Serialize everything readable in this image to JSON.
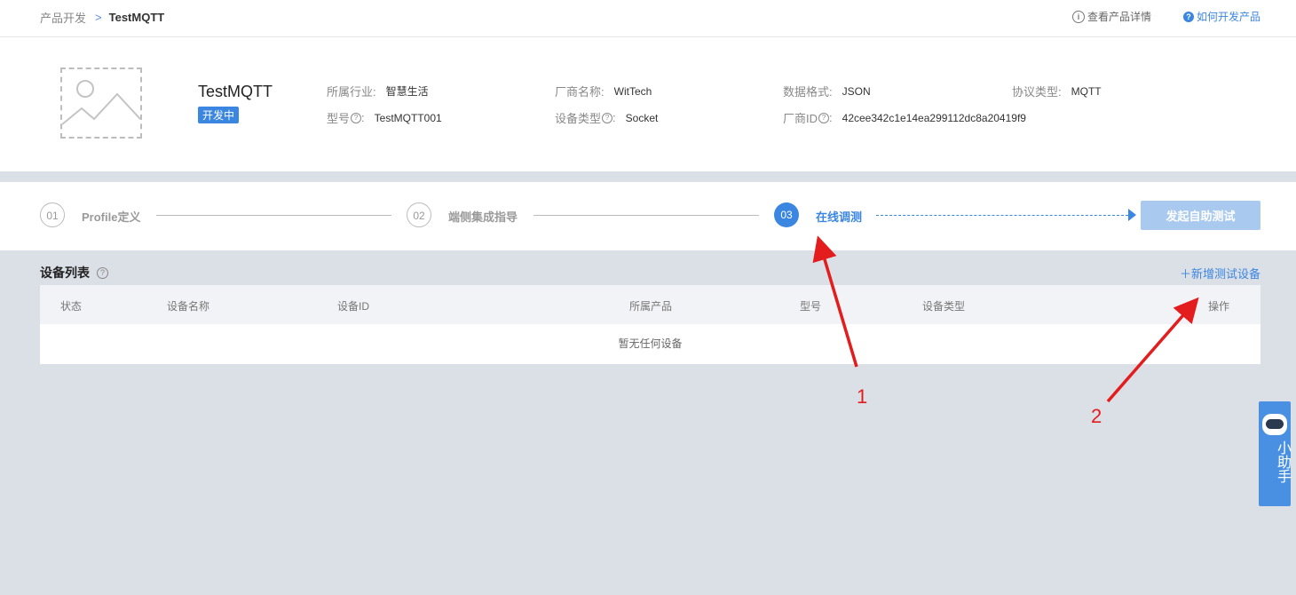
{
  "breadcrumb": {
    "parent": "产品开发",
    "separator": ">",
    "current": "TestMQTT"
  },
  "top_links": {
    "details": "查看产品详情",
    "how_to": "如何开发产品"
  },
  "product": {
    "name": "TestMQTT",
    "status": "开发中",
    "fields": {
      "industry_label": "所属行业:",
      "industry": "智慧生活",
      "vendor_label": "厂商名称:",
      "vendor": "WitTech",
      "data_format_label": "数据格式:",
      "data_format": "JSON",
      "protocol_label": "协议类型:",
      "protocol": "MQTT",
      "model_label": "型号",
      "model": "TestMQTT001",
      "device_type_label": "设备类型",
      "device_type": "Socket",
      "vendor_id_label": "厂商ID",
      "vendor_id": "42cee342c1e14ea299112dc8a20419f9"
    }
  },
  "steps": [
    {
      "num": "01",
      "label": "Profile定义",
      "state": "inactive"
    },
    {
      "num": "02",
      "label": "端侧集成指导",
      "state": "inactive"
    },
    {
      "num": "03",
      "label": "在线调测",
      "state": "active"
    }
  ],
  "self_test_button": "发起自助测试",
  "device_list": {
    "title": "设备列表",
    "add_button": "＋新增测试设备",
    "columns": [
      "状态",
      "设备名称",
      "设备ID",
      "所属产品",
      "型号",
      "设备类型",
      "操作"
    ],
    "empty_text": "暂无任何设备"
  },
  "helper": {
    "label": "小助手"
  },
  "annotations": {
    "one": "1",
    "two": "2",
    "color": "#e31d1d"
  },
  "colors": {
    "accent": "#3b86e0",
    "background": "#dbdfe6"
  }
}
